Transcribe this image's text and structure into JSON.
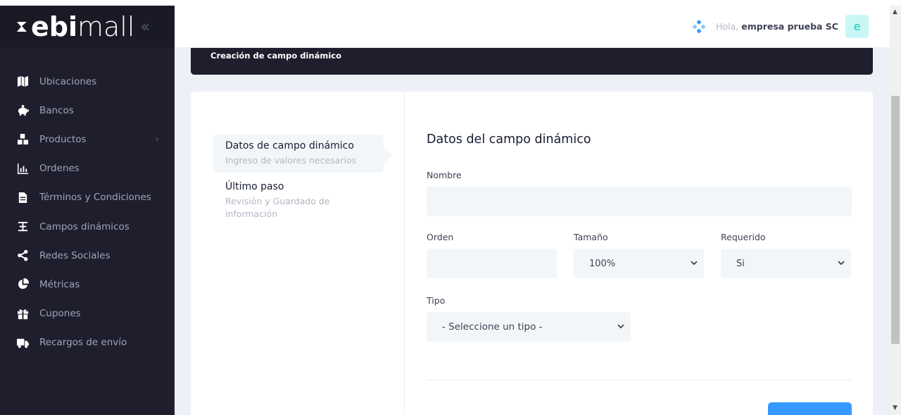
{
  "brand": {
    "logo_bold": "ebi",
    "logo_light": "mall",
    "collapse_glyph": "«"
  },
  "sidebar": {
    "items": [
      {
        "label": "Ubicaciones",
        "icon": "map-icon"
      },
      {
        "label": "Bancos",
        "icon": "piggy-bank-icon"
      },
      {
        "label": "Productos",
        "icon": "boxes-icon",
        "has_submenu": true
      },
      {
        "label": "Ordenes",
        "icon": "bar-chart-icon"
      },
      {
        "label": "Términos y Condiciones",
        "icon": "document-icon"
      },
      {
        "label": "Campos dinámicos",
        "icon": "fields-icon"
      },
      {
        "label": "Redes Sociales",
        "icon": "share-icon"
      },
      {
        "label": "Métricas",
        "icon": "pie-chart-icon"
      },
      {
        "label": "Cupones",
        "icon": "gift-icon"
      },
      {
        "label": "Recargos de envío",
        "icon": "truck-icon"
      }
    ]
  },
  "header": {
    "greeting": "Hola,",
    "user_name": "empresa prueba SC",
    "avatar_letter": "e"
  },
  "banner": {
    "title": "Creación de campo dinámico"
  },
  "wizard": {
    "steps": [
      {
        "title": "Datos de campo dinámico",
        "subtitle": "Ingreso de valores necesarios",
        "active": true
      },
      {
        "title": "Último paso",
        "subtitle": "Revisión y Guardado de información",
        "active": false
      }
    ]
  },
  "form": {
    "title": "Datos del campo dinámico",
    "nombre_label": "Nombre",
    "nombre_value": "",
    "orden_label": "Orden",
    "orden_value": "",
    "tamano_label": "Tamaño",
    "tamano_value": "100%",
    "requerido_label": "Requerido",
    "requerido_value": "Si",
    "tipo_label": "Tipo",
    "tipo_value": "- Seleccione un tipo -"
  },
  "colors": {
    "sidebar_bg": "#1e1e2d",
    "content_bg": "#eef0f8",
    "primary": "#3699ff",
    "avatar_bg": "#c9f7f5",
    "avatar_fg": "#1bc5bd"
  }
}
